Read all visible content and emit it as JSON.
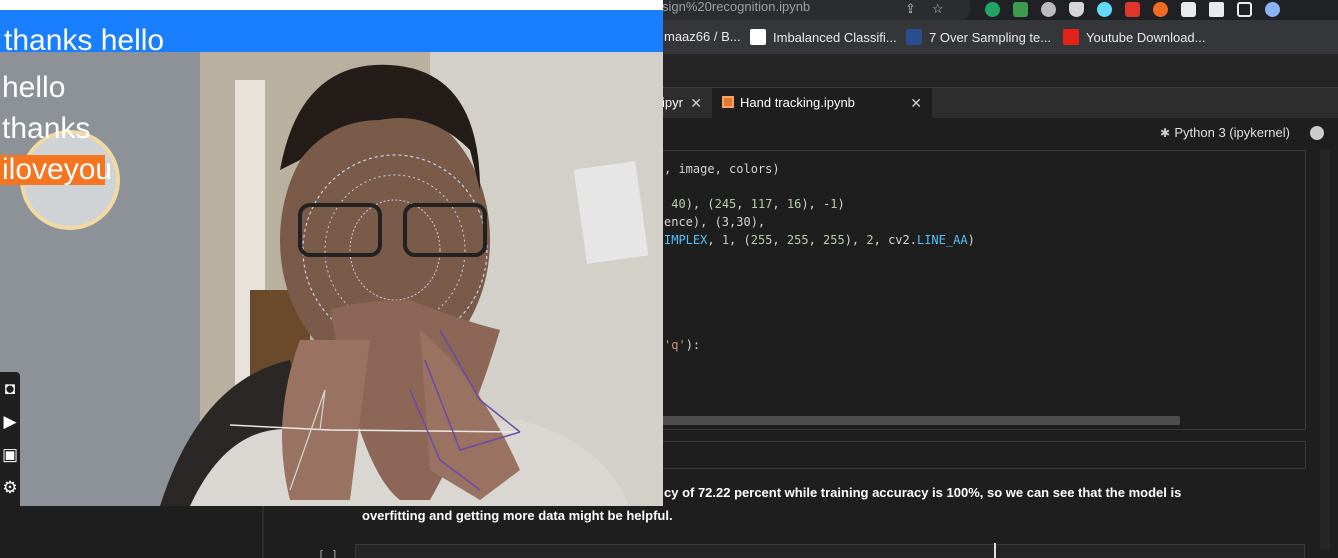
{
  "browser": {
    "address_text": "sign%20recognition.ipynb",
    "bookmarks": [
      {
        "label": "maaz66 / B...",
        "icon": "github-icon"
      },
      {
        "label": "Imbalanced Classifi...",
        "icon": "chart-icon"
      },
      {
        "label": "7 Over Sampling te...",
        "icon": "ids-icon"
      },
      {
        "label": "Youtube Download...",
        "icon": "youtube-icon"
      }
    ]
  },
  "editor": {
    "tabs": [
      {
        "label": "ipyr"
      },
      {
        "label": "Hand tracking.ipynb"
      }
    ],
    "kernel": "Python 3 (ipykernel)",
    "code_lines": [
      ", image, colors)",
      " 40), (245, 117, 16), -1)",
      "ence), (3,30),",
      "IMPLEX, 1, (255, 255, 255), 2, cv2.LINE_AA)",
      "'q'):"
    ],
    "markdown_line1": "cy of 72.22 percent while training accuracy is 100%, so we can see that the model is",
    "markdown_line2": "overfitting and getting more data might be helpful.",
    "cell_label": "[ ]"
  },
  "webcam": {
    "banner_text": "thanks  hello",
    "probabilities": [
      {
        "label": "hello",
        "value": 0.0
      },
      {
        "label": "thanks",
        "value": 0.0
      },
      {
        "label": "iloveyou",
        "value": 1.0
      }
    ],
    "toolbar": [
      "camera-icon",
      "video-icon",
      "image-icon",
      "gear-icon"
    ]
  },
  "colors": {
    "banner": "#1a7fff",
    "prob_bar": "#f57520"
  }
}
